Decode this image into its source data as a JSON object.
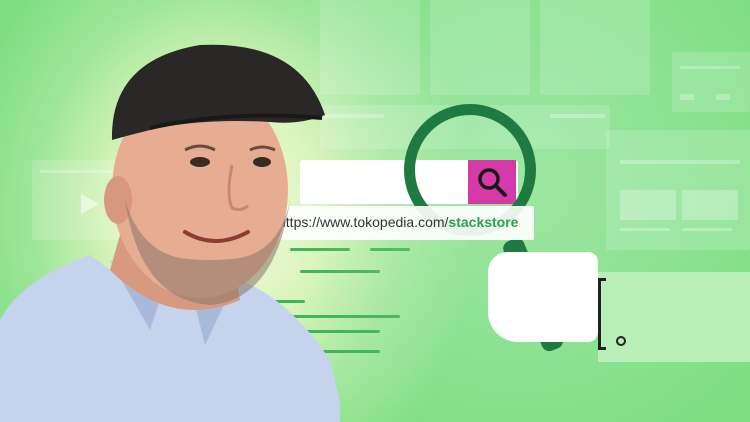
{
  "search": {
    "url_prefix": "https://www.tokopedia.com/",
    "url_slug": "stackstore",
    "icons": {
      "search": "magnifier-icon",
      "store": "tokopedia-bag-icon"
    }
  },
  "colors": {
    "background": "#7dde83",
    "glow": "#f6fbe6",
    "search_button": "#d63aa8",
    "magnifier": "#1f7a42",
    "url_slug": "#2aa34c",
    "cap": "#2a2826",
    "shirt": "#c5d3ec"
  }
}
